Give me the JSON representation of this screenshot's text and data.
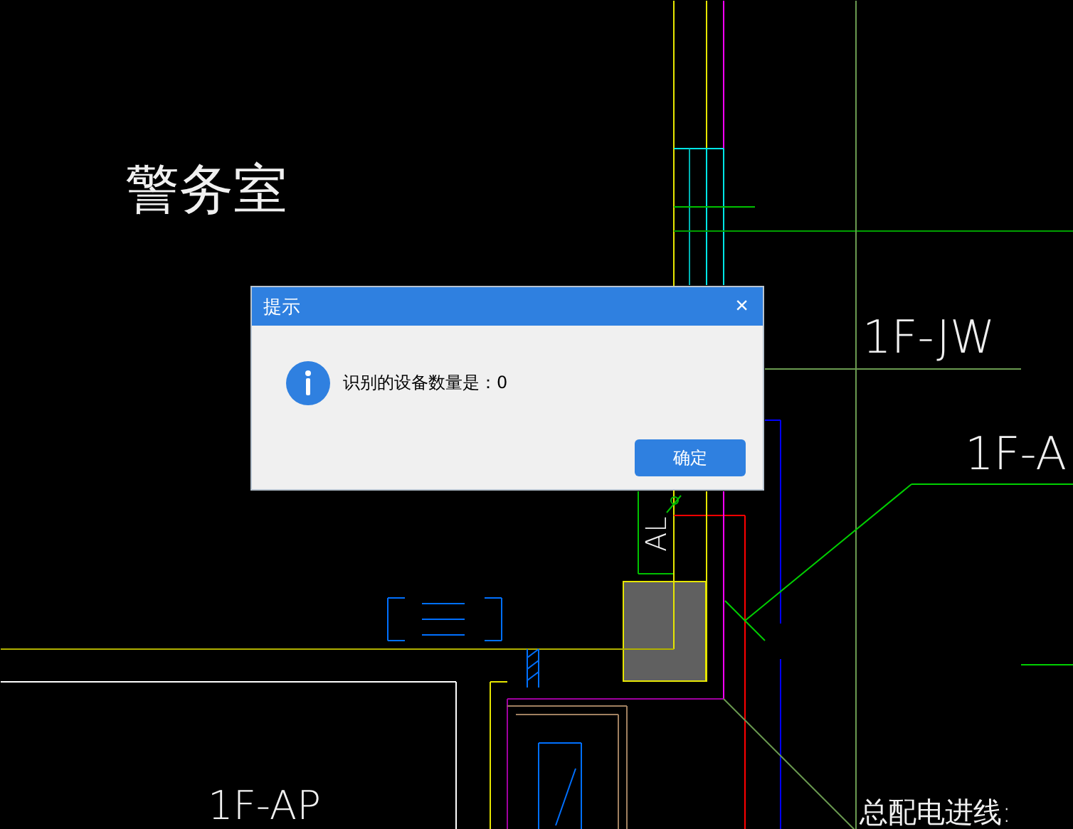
{
  "drawing": {
    "labels": [
      {
        "text": "警务室"
      },
      {
        "text": "1F-JW"
      },
      {
        "text": "1F-A"
      },
      {
        "text": "AL"
      },
      {
        "text": "总配电进线:"
      },
      {
        "text": "1F-AP"
      }
    ]
  },
  "dialog": {
    "title": "提示",
    "close": "×",
    "message": "识别的设备数量是：0",
    "buttons": [
      "确定"
    ]
  }
}
